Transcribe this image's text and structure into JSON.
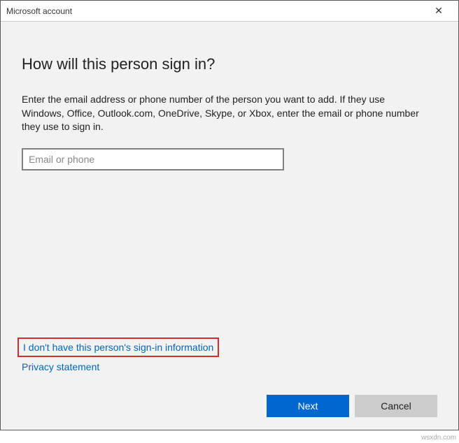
{
  "window": {
    "title": "Microsoft account",
    "close_symbol": "✕"
  },
  "main": {
    "heading": "How will this person sign in?",
    "description": "Enter the email address or phone number of the person you want to add. If they use Windows, Office, Outlook.com, OneDrive, Skype, or Xbox, enter the email or phone number they use to sign in.",
    "input_value": "",
    "input_placeholder": "Email or phone"
  },
  "links": {
    "no_signin_info": "I don't have this person's sign-in information",
    "privacy": "Privacy statement"
  },
  "buttons": {
    "next": "Next",
    "cancel": "Cancel"
  },
  "watermark": "wsxdn.com"
}
